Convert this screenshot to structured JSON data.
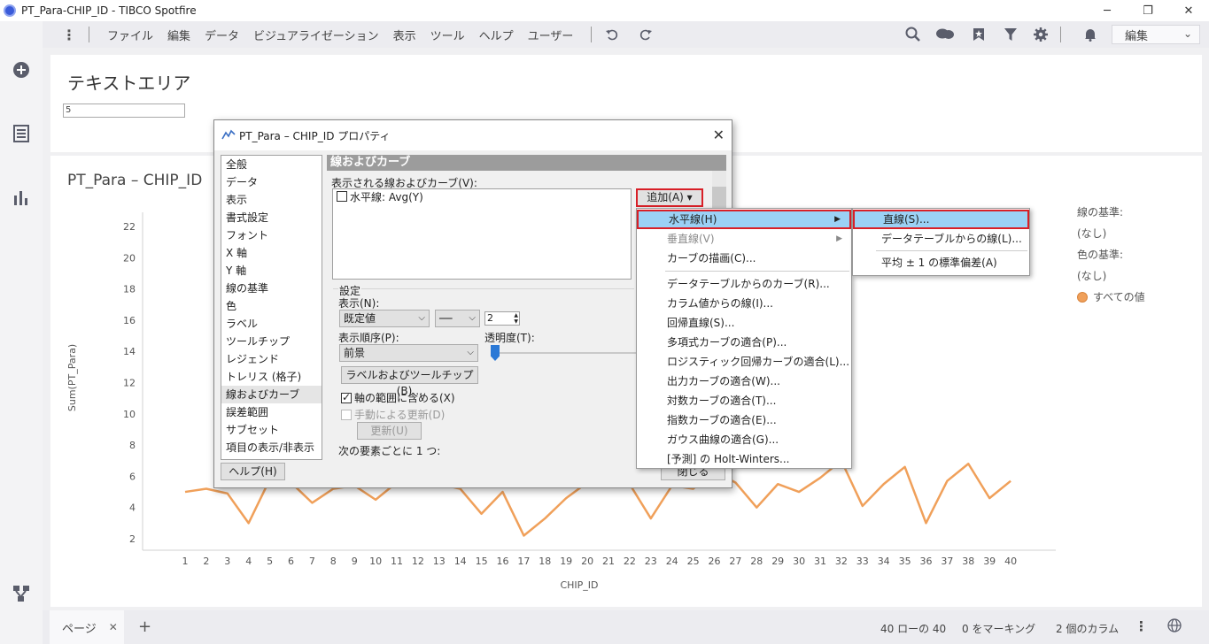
{
  "window": {
    "title": "PT_Para-CHIP_ID - TIBCO Spotfire",
    "minimize": "─",
    "restore": "❐",
    "close": "✕"
  },
  "menubar": {
    "items": [
      "ファイル",
      "編集",
      "データ",
      "ビジュアライゼーション",
      "表示",
      "ツール",
      "ヘルプ",
      "ユーザー"
    ],
    "mode": "編集"
  },
  "text_area": {
    "heading": "テキストエリア",
    "input_value": "5"
  },
  "chart": {
    "title": "PT_Para – CHIP_ID",
    "legend": {
      "line_basis_label": "線の基準:",
      "line_basis_value": "(なし)",
      "color_basis_label": "色の基準:",
      "color_basis_value": "(なし)",
      "all_values": "すべての値"
    }
  },
  "chart_data": {
    "type": "line",
    "xlabel": "CHIP_ID",
    "ylabel": "Sum(PT_Para)",
    "ylim": [
      1,
      23
    ],
    "yticks": [
      2,
      4,
      6,
      8,
      10,
      12,
      14,
      16,
      18,
      20,
      22
    ],
    "categories": [
      "1",
      "2",
      "3",
      "4",
      "5",
      "6",
      "7",
      "8",
      "9",
      "10",
      "11",
      "12",
      "13",
      "14",
      "15",
      "16",
      "17",
      "18",
      "19",
      "20",
      "21",
      "22",
      "23",
      "24",
      "25",
      "26",
      "27",
      "28",
      "29",
      "30",
      "31",
      "32",
      "33",
      "34",
      "35",
      "36",
      "37",
      "38",
      "39",
      "40"
    ],
    "series": [
      {
        "color": "#f0a05a",
        "values": [
          5.0,
          5.2,
          4.9,
          3.0,
          5.8,
          5.6,
          4.3,
          5.2,
          5.4,
          4.5,
          5.6,
          5.7,
          5.5,
          5.2,
          3.6,
          5.0,
          2.2,
          3.3,
          4.6,
          5.6,
          5.4,
          5.5,
          3.3,
          5.4,
          5.2,
          6.3,
          5.6,
          4.0,
          5.5,
          5.0,
          5.9,
          7.0,
          4.1,
          5.5,
          6.6,
          3.0,
          5.7,
          6.8,
          4.6,
          5.7
        ]
      }
    ]
  },
  "statusbar": {
    "page_tab": "ページ",
    "rows": "40 ローの 40",
    "marking": "0 をマーキング",
    "columns": "2 個のカラム"
  },
  "dialog": {
    "title": "PT_Para – CHIP_ID プロパティ",
    "nav": [
      "全般",
      "データ",
      "表示",
      "書式設定",
      "フォント",
      "X 軸",
      "Y 軸",
      "線の基準",
      "色",
      "ラベル",
      "ツールチップ",
      "レジェンド",
      "トレリス (格子)",
      "線およびカーブ",
      "誤差範囲",
      "サブセット",
      "項目の表示/非表示"
    ],
    "nav_selected": 13,
    "section_title": "線およびカーブ",
    "shown_label": "表示される線およびカーブ(V):",
    "curve_item": "水平線: Avg(Y)",
    "add_button": "追加(A) ▾",
    "settings_label": "設定",
    "display_label": "表示(N):",
    "display_value": "既定値",
    "line_style": "──",
    "line_width": "2",
    "order_label": "表示順序(P):",
    "order_value": "前景",
    "transparency_label": "透明度(T):",
    "labels_button": "ラベルおよびツールチップ(B)…",
    "include_axis": "軸の範囲に含める(X)",
    "manual_update": "手動による更新(D)",
    "update_button": "更新(U)",
    "per_element": "次の要素ごとに 1 つ:",
    "help_button": "ヘルプ(H)",
    "close_button": "閉じる"
  },
  "add_menu": {
    "items": [
      {
        "label": "水平線(H)",
        "sub": true,
        "state": "highlight"
      },
      {
        "label": "垂直線(V)",
        "sub": true,
        "state": "disabled"
      },
      {
        "label": "カーブの描画(C)...",
        "sub": false,
        "state": "normal"
      },
      {
        "label": "データテーブルからのカーブ(R)...",
        "sub": false,
        "state": "normal"
      },
      {
        "label": "カラム値からの線(I)...",
        "sub": false,
        "state": "normal"
      },
      {
        "label": "回帰直線(S)...",
        "sub": false,
        "state": "normal"
      },
      {
        "label": "多項式カーブの適合(P)...",
        "sub": false,
        "state": "normal"
      },
      {
        "label": "ロジスティック回帰カーブの適合(L)...",
        "sub": false,
        "state": "normal"
      },
      {
        "label": "出力カーブの適合(W)...",
        "sub": false,
        "state": "normal"
      },
      {
        "label": "対数カーブの適合(T)...",
        "sub": false,
        "state": "normal"
      },
      {
        "label": "指数カーブの適合(E)...",
        "sub": false,
        "state": "normal"
      },
      {
        "label": "ガウス曲線の適合(G)...",
        "sub": false,
        "state": "normal"
      },
      {
        "label": "[予測] の Holt-Winters...",
        "sub": false,
        "state": "normal"
      }
    ]
  },
  "sub_menu": {
    "items": [
      "直線(S)...",
      "データテーブルからの線(L)...",
      "平均 ± 1 の標準偏差(A)"
    ]
  }
}
